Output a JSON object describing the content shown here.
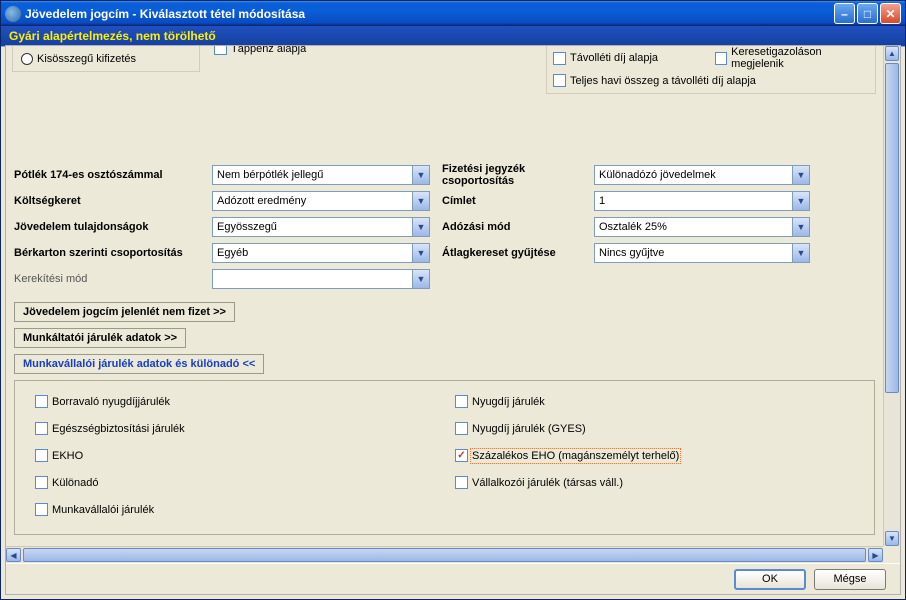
{
  "window": {
    "title": "Jövedelem jogcím - Kiválasztott tétel módosítása",
    "subheader": "Gyári alapértelmezés, nem törölhető"
  },
  "radio": {
    "label": "Kisösszegű kifizetés"
  },
  "topChecks": {
    "left": "Táppénz alapja",
    "r1": "Távolléti díj alapja",
    "r2": "Keresetigazoláson megjelenik",
    "r3": "Teljes havi összeg a távolléti díj alapja"
  },
  "form": {
    "l1": "Pótlék 174-es osztószámmal",
    "l2": "Költségkeret",
    "l3": "Jövedelem tulajdonságok",
    "l4": "Bérkarton szerinti csoportosítás",
    "l5": "Kerekítési mód",
    "r1": "Fizetési jegyzék csoportosítás",
    "r2": "Címlet",
    "r3": "Adózási mód",
    "r4": "Átlagkereset gyűjtése",
    "v1": "Nem bérpótlék jellegű",
    "v2": "Adózott eredmény",
    "v3": "Egyösszegű",
    "v4": "Egyéb",
    "v5": "",
    "vr1": "Különadózó jövedelmek",
    "vr2": "1",
    "vr3": "Osztalék 25%",
    "vr4": "Nincs gyűjtve"
  },
  "sections": {
    "s1": "Jövedelem jogcím jelenlét nem fizet  >>",
    "s2": "Munkáltatói járulék adatok  >>",
    "s3": "Munkavállalói járulék adatok és különadó  <<"
  },
  "panel": {
    "left": [
      "Borravaló nyugdíjjárulék",
      "Egészségbiztosítási járulék",
      "EKHO",
      "Különadó",
      "Munkavállalói járulék"
    ],
    "right": [
      "Nyugdíj járulék",
      "Nyugdíj járulék (GYES)",
      "Százalékos EHO (magánszemélyt terhelő)",
      "Vállalkozói járulék (társas váll.)"
    ],
    "checked_right_index": 2
  },
  "buttons": {
    "ok": "OK",
    "cancel": "Mégse"
  }
}
